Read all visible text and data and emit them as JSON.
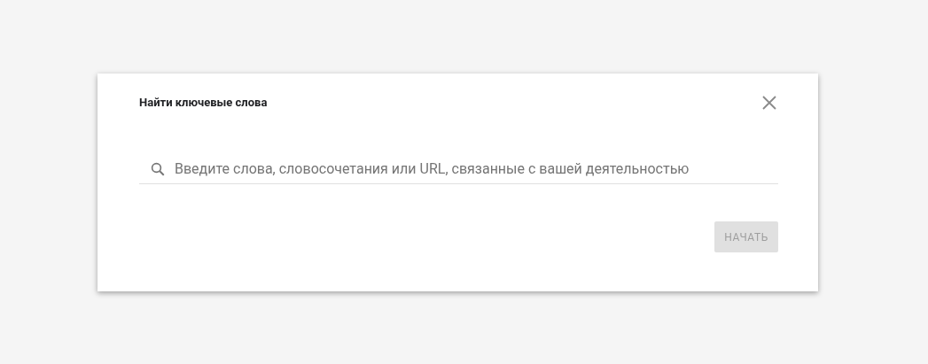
{
  "dialog": {
    "title": "Найти ключевые слова",
    "search": {
      "placeholder": "Введите слова, словосочетания или URL, связанные с вашей деятельностью"
    },
    "button": {
      "label": "НАЧАТЬ",
      "disabled": true
    }
  }
}
